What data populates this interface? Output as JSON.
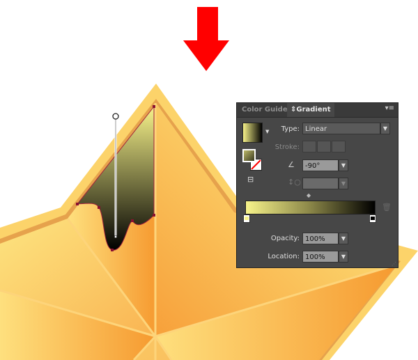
{
  "panel": {
    "tabs": [
      {
        "label": "Color Guide",
        "active": false
      },
      {
        "label": "Gradient",
        "active": true
      }
    ],
    "tab_arrows": "⇕",
    "menu_icon": "panel-menu-icon",
    "type_label": "Type:",
    "type_value": "Linear",
    "stroke_label": "Stroke:",
    "angle_value": "-90°",
    "aspect_value": "",
    "opacity_label": "Opacity:",
    "opacity_value": "100%",
    "location_label": "Location:",
    "location_value": "100%",
    "gradient_stops": [
      "#f7f38a",
      "#000000"
    ]
  },
  "colors": {
    "arrow": "#ff0000",
    "star_light": "#fde07a",
    "star_dark": "#f7a43a",
    "border": "#e8a24a"
  }
}
